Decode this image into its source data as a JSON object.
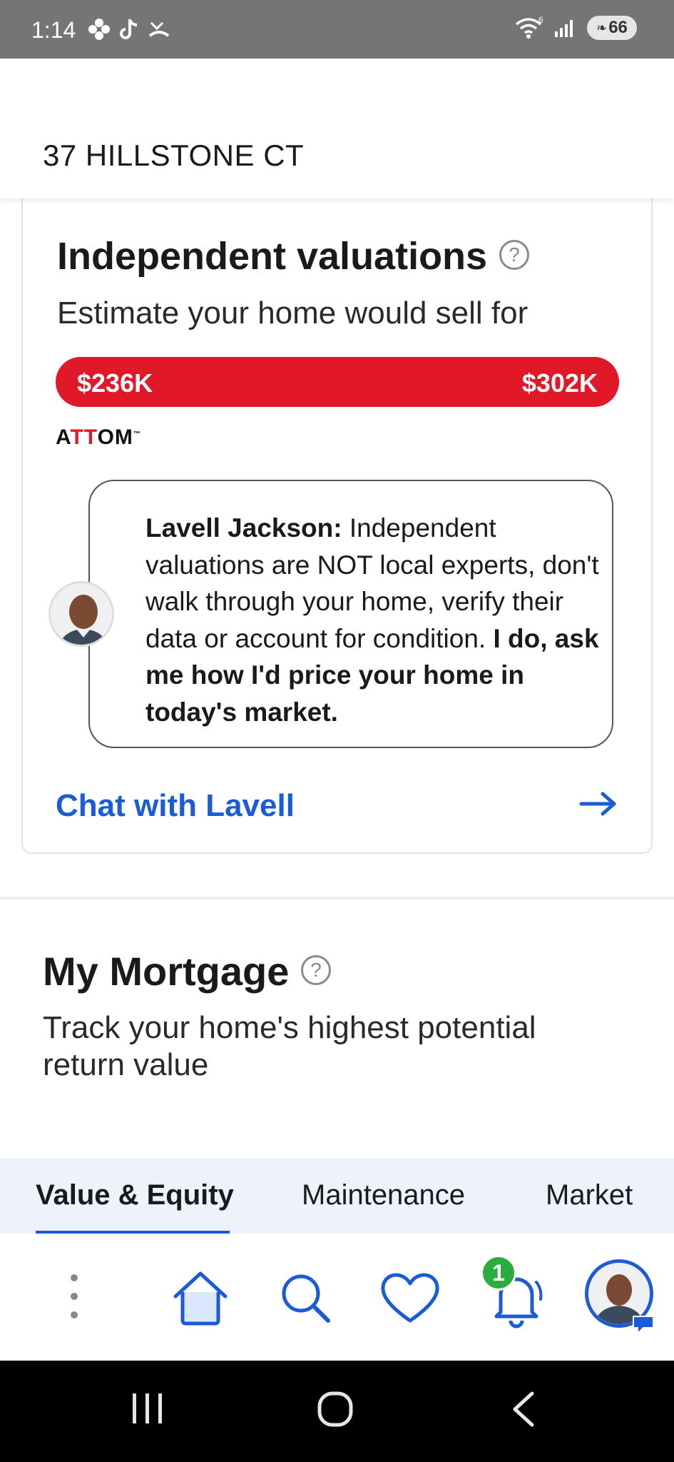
{
  "status_bar": {
    "time": "1:14",
    "left_icons": [
      "pinwheel-icon",
      "tiktok-icon",
      "missed-call-icon"
    ],
    "network_label": "6",
    "battery_level": "66"
  },
  "header": {
    "address": "37 HILLSTONE CT"
  },
  "valuation_card": {
    "title": "Independent valuations",
    "subtitle": "Estimate your home would sell for",
    "range_low": "$236K",
    "range_high": "$302K",
    "range_color": "#e01827",
    "provider_prefix": "A",
    "provider_mid": "TT",
    "provider_suffix": "OM",
    "provider_tm": "™",
    "agent_name": "Lavell Jackson:",
    "message_plain": " Independent valuations are NOT local experts, don't walk through your home, verify their data or account for condition. ",
    "message_bold": "I do, ask me how I'd price your home in today's market.",
    "chat_link": "Chat with Lavell"
  },
  "mortgage": {
    "title": "My Mortgage",
    "subtitle": "Track your home's highest potential return value"
  },
  "tabs": [
    {
      "label": "Value & Equity",
      "active": true
    },
    {
      "label": "Maintenance",
      "active": false
    },
    {
      "label": "Market",
      "active": false
    }
  ],
  "bottom_nav": {
    "items": [
      "more-icon",
      "home-icon",
      "search-icon",
      "heart-icon",
      "bell-icon",
      "profile-avatar"
    ],
    "notification_count": "1",
    "accent_color": "#1a5bd8"
  },
  "system_nav": [
    "recents-icon",
    "home-circle-icon",
    "back-icon"
  ]
}
